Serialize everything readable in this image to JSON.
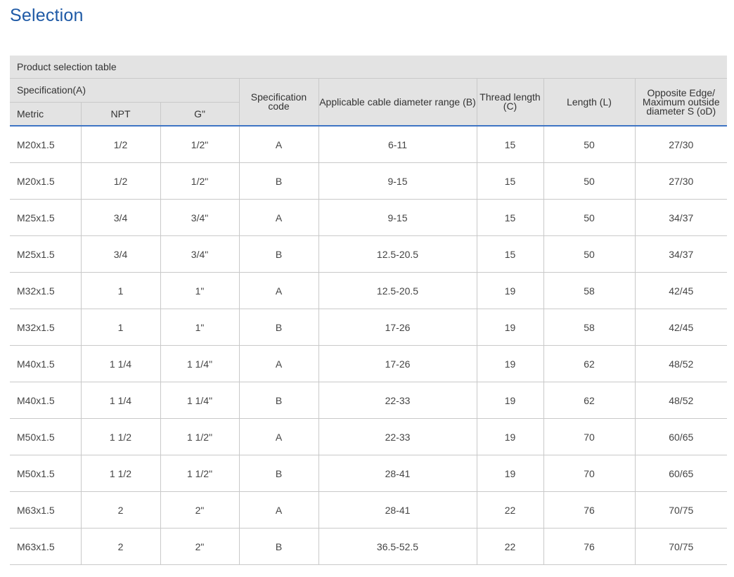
{
  "page": {
    "title": "Selection"
  },
  "table": {
    "caption": "Product selection table",
    "group_header": "Specification(A)",
    "sub_headers": [
      "Metric",
      "NPT",
      "G\""
    ],
    "headers": [
      "Specification code",
      "Applicable cable diameter range (B)",
      "Thread length (C)",
      "Length (L)",
      "Opposite Edge/ Maximum outside diameter S (oD)"
    ],
    "rows": [
      [
        "M20x1.5",
        "1/2",
        "1/2\"",
        "A",
        "6-11",
        "15",
        "50",
        "27/30"
      ],
      [
        "M20x1.5",
        "1/2",
        "1/2\"",
        "B",
        "9-15",
        "15",
        "50",
        "27/30"
      ],
      [
        "M25x1.5",
        "3/4",
        "3/4\"",
        "A",
        "9-15",
        "15",
        "50",
        "34/37"
      ],
      [
        "M25x1.5",
        "3/4",
        "3/4\"",
        "B",
        "12.5-20.5",
        "15",
        "50",
        "34/37"
      ],
      [
        "M32x1.5",
        "1",
        "1\"",
        "A",
        "12.5-20.5",
        "19",
        "58",
        "42/45"
      ],
      [
        "M32x1.5",
        "1",
        "1\"",
        "B",
        "17-26",
        "19",
        "58",
        "42/45"
      ],
      [
        "M40x1.5",
        "1 1/4",
        "1 1/4\"",
        "A",
        "17-26",
        "19",
        "62",
        "48/52"
      ],
      [
        "M40x1.5",
        "1 1/4",
        "1 1/4\"",
        "B",
        "22-33",
        "19",
        "62",
        "48/52"
      ],
      [
        "M50x1.5",
        "1 1/2",
        "1 1/2\"",
        "A",
        "22-33",
        "19",
        "70",
        "60/65"
      ],
      [
        "M50x1.5",
        "1 1/2",
        "1 1/2\"",
        "B",
        "28-41",
        "19",
        "70",
        "60/65"
      ],
      [
        "M63x1.5",
        "2",
        "2\"",
        "A",
        "28-41",
        "22",
        "76",
        "70/75"
      ],
      [
        "M63x1.5",
        "2",
        "2\"",
        "B",
        "36.5-52.5",
        "22",
        "76",
        "70/75"
      ]
    ]
  },
  "colors": {
    "title": "#1f5aa6",
    "header_bg": "#e3e3e3",
    "header_rule": "#3e74c4",
    "grid": "#c9c9c9"
  }
}
